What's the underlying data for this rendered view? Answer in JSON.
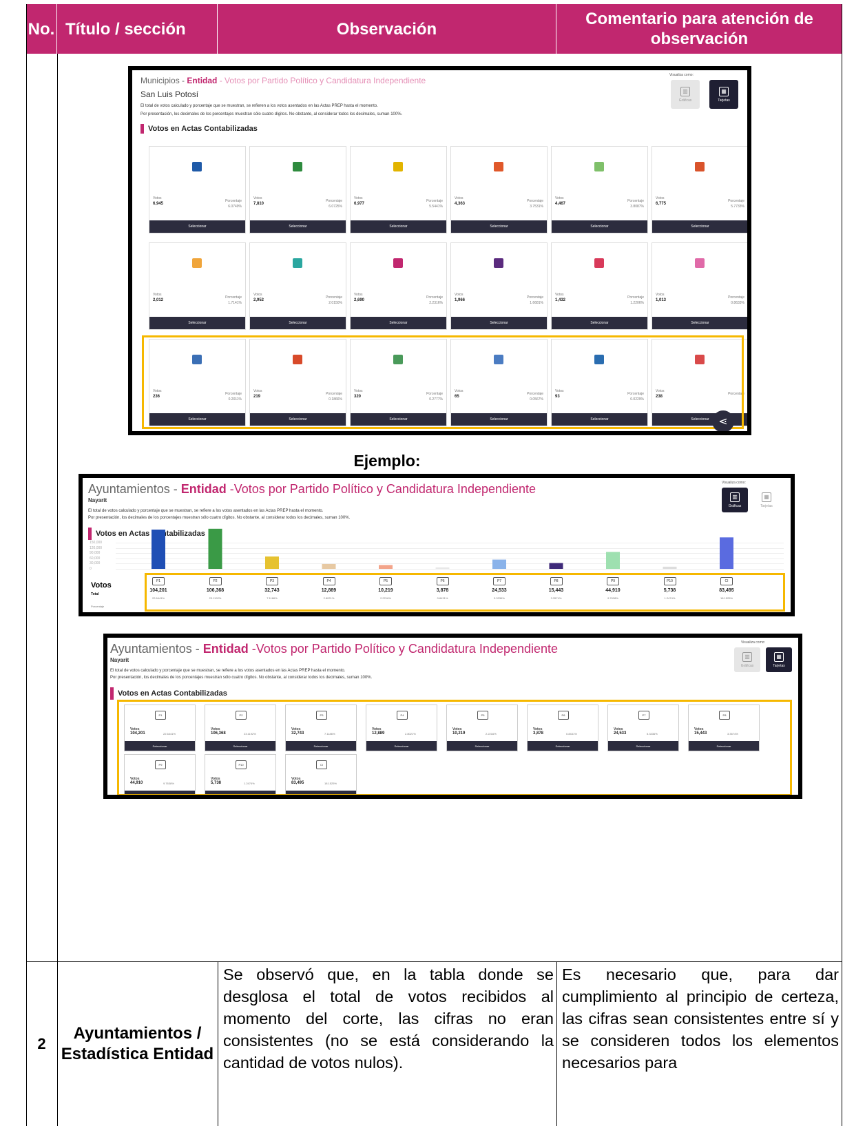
{
  "header": {
    "col_no": "No.",
    "col_titulo": "Título / sección",
    "col_observacion": "Observación",
    "col_comentario": "Comentario para atención de observación"
  },
  "shot1": {
    "title_prefix": "Municipios - ",
    "title_entidad": "Entidad",
    "title_rest": " - Votos por Partido Político y Candidatura Independiente",
    "subtitle": "San Luis Potosí",
    "note1": "El total de votos calculado y porcentaje que se muestran, se refieren a los votos asentados en las Actas PREP hasta el momento.",
    "note2": "Por presentación, los decimales de los porcentajes muestran sólo cuatro dígitos. No obstante, al considerar todos los decimales, suman 100%.",
    "section": "Votos en Actas Contabilizadas",
    "visualiza": "Visualiza como:",
    "btn_graficas": "Gráficas",
    "btn_tarjetas": "Tarjetas",
    "votos_label": "Votos",
    "pct_label": "Porcentaje",
    "select_label": "Seleccionar",
    "tiles": [
      {
        "votos": "6,945",
        "pct": "6.0749%",
        "color": "#1f5aa8"
      },
      {
        "votos": "7,810",
        "pct": "6.0725%",
        "color": "#2e8b3e"
      },
      {
        "votos": "6,977",
        "pct": "5.5441%",
        "color": "#e2b400"
      },
      {
        "votos": "4,363",
        "pct": "3.7531%",
        "color": "#e0582a"
      },
      {
        "votos": "4,467",
        "pct": "3.8087%",
        "color": "#7fc06a"
      },
      {
        "votos": "6,775",
        "pct": "5.7733%",
        "color": "#d9532b"
      },
      {
        "votos": "2,012",
        "pct": "1.7141%",
        "color": "#f0a53b"
      },
      {
        "votos": "2,952",
        "pct": "2.0150%",
        "color": "#2ba7a0"
      },
      {
        "votos": "2,690",
        "pct": "2.2316%",
        "color": "#c1276f"
      },
      {
        "votos": "1,966",
        "pct": "1.6681%",
        "color": "#5b2b7e"
      },
      {
        "votos": "1,432",
        "pct": "1.2206%",
        "color": "#d83a5a"
      },
      {
        "votos": "1,013",
        "pct": "0.8633%",
        "color": "#e06aa8"
      },
      {
        "votos": "236",
        "pct": "0.2011%",
        "color": "#3b6fb5"
      },
      {
        "votos": "219",
        "pct": "0.1866%",
        "color": "#d84a2a"
      },
      {
        "votos": "320",
        "pct": "0.2777%",
        "color": "#4a9a5a"
      },
      {
        "votos": "65",
        "pct": "0.0567%",
        "color": "#4b7cc2"
      },
      {
        "votos": "93",
        "pct": "0.0229%",
        "color": "#2a6db0"
      },
      {
        "votos": "238",
        "pct": "",
        "color": "#d94a4a"
      }
    ]
  },
  "ejemplo": "Ejemplo:",
  "shot2": {
    "title_prefix": "Ayuntamientos - ",
    "title_entidad": "Entidad",
    "title_rest": " -Votos por Partido Político y Candidatura Independiente",
    "subtitle": "Nayarit",
    "note1": "El total de votos calculado y porcentaje que se muestran, se refiere a los votos asentados en las Actas PREP hasta el momento.",
    "note2": "Por presentación, los decimales de los porcentajes muestran sólo cuatro dígitos. No obstante, al considerar todos los decimales, suman 100%.",
    "section": "Votos en Actas Contabilizadas",
    "visualiza": "Visualiza como:",
    "btn_graficas": "Gráficas",
    "btn_tarjetas": "Tarjetas",
    "votos_label": "Votos",
    "total_label": "Total",
    "pct_label": "Porcentaje",
    "grid_labels": [
      "150,000",
      "120,000",
      "90,000",
      "60,000",
      "30,000",
      "0"
    ]
  },
  "chart_data": {
    "type": "bar",
    "categories": [
      "P1",
      "P2",
      "P3",
      "P4",
      "P5",
      "P6",
      "P7",
      "P8",
      "P9",
      "P10",
      "CI"
    ],
    "values": [
      104201,
      106368,
      32743,
      12889,
      10219,
      3878,
      24533,
      15443,
      44910,
      5738,
      83495
    ],
    "totals_text": [
      "104,201",
      "106,368",
      "32,743",
      "12,889",
      "10,219",
      "3,878",
      "24,533",
      "15,443",
      "44,910",
      "5,738",
      "83,495"
    ],
    "percentages": [
      "22.6441%",
      "23.1192%",
      "7.1186%",
      "2.8021%",
      "2.2216%",
      "0.8431%",
      "5.3336%",
      "3.3574%",
      "9.7638%",
      "1.2474%",
      "18.1525%"
    ],
    "colors": [
      "#1f4fb5",
      "#3a9a46",
      "#e6c230",
      "#e7c9a3",
      "#f3a48a",
      "#e8e8e8",
      "#8ab3ea",
      "#3f2a7a",
      "#9ee0b0",
      "#dddddd",
      "#5a6be0"
    ],
    "ylim": [
      0,
      150000
    ],
    "grid": true
  },
  "shot3": {
    "title_prefix": "Ayuntamientos - ",
    "title_entidad": "Entidad",
    "title_rest": " -Votos por Partido Político y Candidatura Independiente",
    "subtitle": "Nayarit",
    "note1": "El total de votos calculado y porcentaje que se muestran, se refiere a los votos asentados en las Actas PREP hasta el momento.",
    "note2": "Por presentación, los decimales de los porcentajes muestran sólo cuatro dígitos. No obstante, al considerar todos los decimales, suman 100%.",
    "section": "Votos en Actas Contabilizadas",
    "visualiza": "Visualiza como:",
    "btn_graficas": "Gráficas",
    "btn_tarjetas": "Tarjetas",
    "votos_label": "Votos",
    "select_label": "Seleccionar"
  },
  "row2": {
    "no": "2",
    "titulo": "Ayuntamientos / Estadística Entidad",
    "observacion": "Se observó que, en la tabla donde se desglosa el total de votos recibidos al momento del corte, las cifras no eran consistentes (no se está considerando la cantidad de votos nulos).",
    "comentario": "Es necesario que, para dar cumplimiento al principio de certeza, las cifras sean consistentes entre sí y se consideren todos los elementos necesarios para"
  }
}
